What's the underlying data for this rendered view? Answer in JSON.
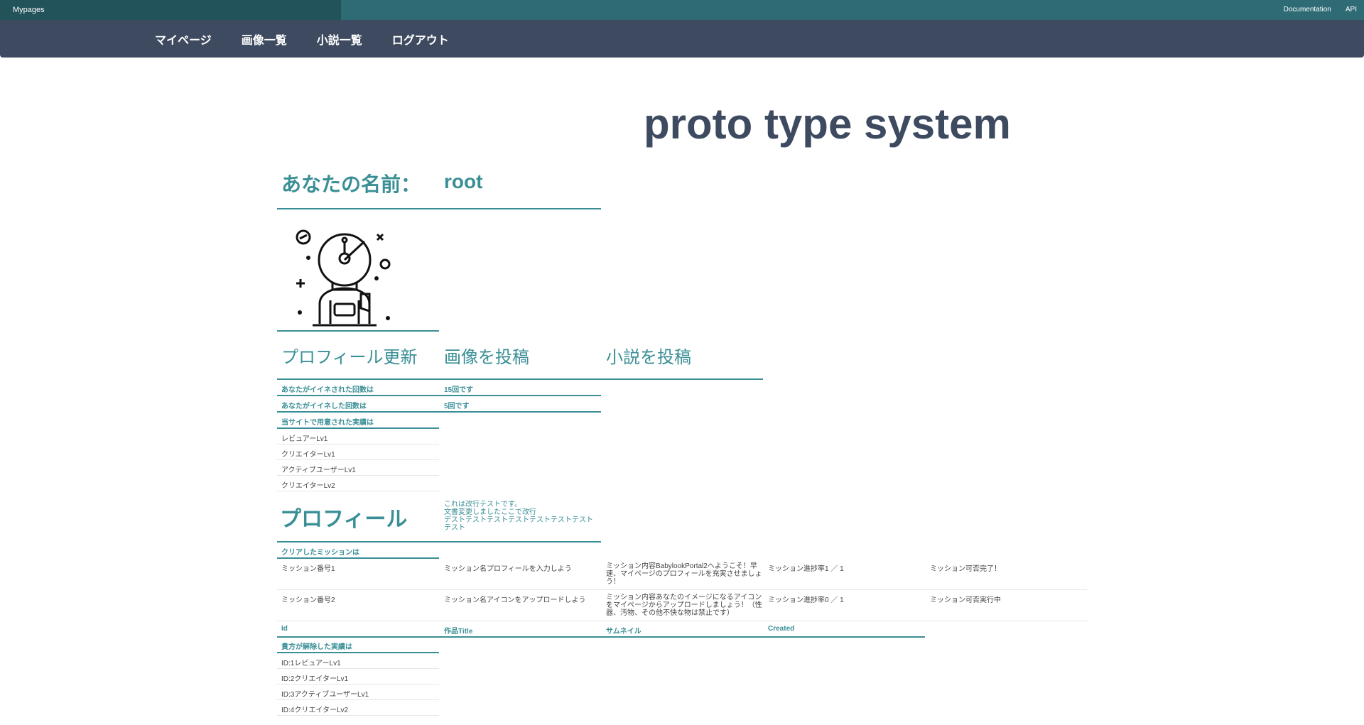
{
  "topbar": {
    "brand": "Mypages",
    "links": [
      "Documentation",
      "API"
    ]
  },
  "nav": {
    "items": [
      "マイページ",
      "画像一覧",
      "小説一覧",
      "ログアウト"
    ]
  },
  "site_title": "proto type system",
  "user": {
    "name_label": "あなたの名前：",
    "name": "root"
  },
  "avatar_icon": "astronaut-icon",
  "actions": [
    "プロフィール更新",
    "画像を投稿",
    "小説を投稿"
  ],
  "stats": {
    "liked_label": "あなたがイイネされた回数は",
    "liked_value": "15回です",
    "likes_given_label": "あなたがイイネした回数は",
    "likes_given_value": "5回です"
  },
  "achievements": {
    "header": "当サイトで用意された実績は",
    "items": [
      "レビュアーLv1",
      "クリエイターLv1",
      "アクティブユーザーLv1",
      "クリエイターLv2"
    ]
  },
  "profile": {
    "heading": "プロフィール",
    "text": "これは改行テストです。\n文書変更しましたここで改行\nデストテストテストテストテストテストテスト\nテスト"
  },
  "missions": {
    "header": "クリアしたミッションは",
    "rows": [
      {
        "number": "ミッション番号1",
        "name": "ミッション名プロフィールを入力しよう",
        "description": "ミッション内容BabylookPortal2へようこそ！早速、マイページのプロフィールを充実させましょう！",
        "progress": "ミッション進捗率1 ／ 1",
        "status": "ミッション可否完了！"
      },
      {
        "number": "ミッション番号2",
        "name": "ミッション名アイコンをアップロードしよう",
        "description": "ミッション内容あなたのイメージになるアイコンをマイページからアップロードしましょう！（性器、汚物、その他不快な物は禁止です）",
        "progress": "ミッション進捗率0 ／ 1",
        "status": "ミッション可否実行中"
      }
    ]
  },
  "works_table": {
    "headers": [
      "Id",
      "作品Title",
      "サムネイル",
      "Created"
    ]
  },
  "unlocked": {
    "header": "貴方が解除した実績は",
    "items": [
      "ID:1レビュアーLv1",
      "ID:2クリエイターLv1",
      "ID:3アクティブユーザーLv1",
      "ID:4クリエイターLv2"
    ]
  }
}
